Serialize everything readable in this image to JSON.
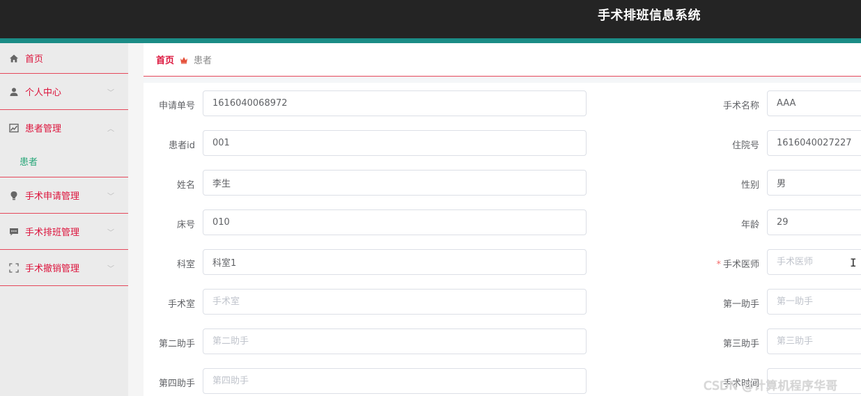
{
  "header": {
    "title": "手术排班信息系统"
  },
  "sidebar": {
    "items": [
      {
        "label": "首页",
        "icon": "home-icon"
      },
      {
        "label": "个人中心",
        "icon": "user-icon",
        "expandable": true
      },
      {
        "label": "患者管理",
        "icon": "chart-icon",
        "expandable": true,
        "expanded": true
      },
      {
        "label": "患者",
        "sub": true
      },
      {
        "label": "手术申请管理",
        "icon": "bulb-icon",
        "expandable": true
      },
      {
        "label": "手术排班管理",
        "icon": "message-icon",
        "expandable": true
      },
      {
        "label": "手术撤销管理",
        "icon": "fullscreen-icon",
        "expandable": true
      }
    ],
    "chevron_down": "﹀",
    "chevron_up": "︿"
  },
  "breadcrumb": {
    "home": "首页",
    "current": "患者"
  },
  "form": {
    "left": [
      {
        "label": "申请单号",
        "value": "1616040068972",
        "placeholder": ""
      },
      {
        "label": "患者id",
        "value": "001",
        "placeholder": ""
      },
      {
        "label": "姓名",
        "value": "李生",
        "placeholder": ""
      },
      {
        "label": "床号",
        "value": "010",
        "placeholder": ""
      },
      {
        "label": "科室",
        "value": "科室1",
        "placeholder": ""
      },
      {
        "label": "手术室",
        "value": "",
        "placeholder": "手术室"
      },
      {
        "label": "第二助手",
        "value": "",
        "placeholder": "第二助手"
      },
      {
        "label": "第四助手",
        "value": "",
        "placeholder": "第四助手"
      }
    ],
    "right": [
      {
        "label": "手术名称",
        "value": "AAA",
        "placeholder": ""
      },
      {
        "label": "住院号",
        "value": "1616040027227",
        "placeholder": ""
      },
      {
        "label": "性别",
        "value": "男",
        "placeholder": ""
      },
      {
        "label": "年龄",
        "value": "29",
        "placeholder": ""
      },
      {
        "label": "手术医师",
        "value": "",
        "placeholder": "手术医师",
        "required": true
      },
      {
        "label": "第一助手",
        "value": "",
        "placeholder": "第一助手"
      },
      {
        "label": "第三助手",
        "value": "",
        "placeholder": "第三助手"
      },
      {
        "label": "手术时间",
        "value": "",
        "placeholder": ""
      }
    ],
    "required_mark": "*"
  },
  "watermark": "CSDN @计算机程序华哥",
  "colors": {
    "accent": "#dc143c",
    "teal": "#1b8c86",
    "active_sub": "#2aa77a",
    "header_bg": "#242424"
  }
}
